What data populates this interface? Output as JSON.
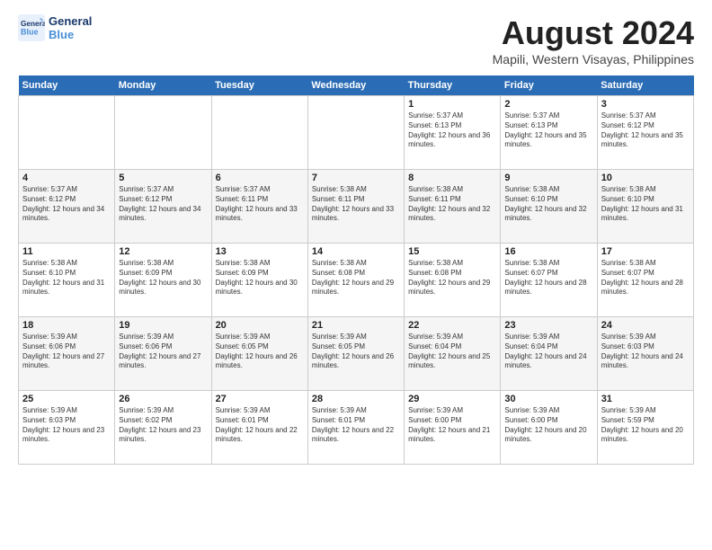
{
  "logo": {
    "line1": "General",
    "line2": "Blue"
  },
  "title": "August 2024",
  "location": "Mapili, Western Visayas, Philippines",
  "headers": [
    "Sunday",
    "Monday",
    "Tuesday",
    "Wednesday",
    "Thursday",
    "Friday",
    "Saturday"
  ],
  "weeks": [
    [
      {
        "day": "",
        "info": ""
      },
      {
        "day": "",
        "info": ""
      },
      {
        "day": "",
        "info": ""
      },
      {
        "day": "",
        "info": ""
      },
      {
        "day": "1",
        "info": "Sunrise: 5:37 AM\nSunset: 6:13 PM\nDaylight: 12 hours and 36 minutes."
      },
      {
        "day": "2",
        "info": "Sunrise: 5:37 AM\nSunset: 6:13 PM\nDaylight: 12 hours and 35 minutes."
      },
      {
        "day": "3",
        "info": "Sunrise: 5:37 AM\nSunset: 6:12 PM\nDaylight: 12 hours and 35 minutes."
      }
    ],
    [
      {
        "day": "4",
        "info": "Sunrise: 5:37 AM\nSunset: 6:12 PM\nDaylight: 12 hours and 34 minutes."
      },
      {
        "day": "5",
        "info": "Sunrise: 5:37 AM\nSunset: 6:12 PM\nDaylight: 12 hours and 34 minutes."
      },
      {
        "day": "6",
        "info": "Sunrise: 5:37 AM\nSunset: 6:11 PM\nDaylight: 12 hours and 33 minutes."
      },
      {
        "day": "7",
        "info": "Sunrise: 5:38 AM\nSunset: 6:11 PM\nDaylight: 12 hours and 33 minutes."
      },
      {
        "day": "8",
        "info": "Sunrise: 5:38 AM\nSunset: 6:11 PM\nDaylight: 12 hours and 32 minutes."
      },
      {
        "day": "9",
        "info": "Sunrise: 5:38 AM\nSunset: 6:10 PM\nDaylight: 12 hours and 32 minutes."
      },
      {
        "day": "10",
        "info": "Sunrise: 5:38 AM\nSunset: 6:10 PM\nDaylight: 12 hours and 31 minutes."
      }
    ],
    [
      {
        "day": "11",
        "info": "Sunrise: 5:38 AM\nSunset: 6:10 PM\nDaylight: 12 hours and 31 minutes."
      },
      {
        "day": "12",
        "info": "Sunrise: 5:38 AM\nSunset: 6:09 PM\nDaylight: 12 hours and 30 minutes."
      },
      {
        "day": "13",
        "info": "Sunrise: 5:38 AM\nSunset: 6:09 PM\nDaylight: 12 hours and 30 minutes."
      },
      {
        "day": "14",
        "info": "Sunrise: 5:38 AM\nSunset: 6:08 PM\nDaylight: 12 hours and 29 minutes."
      },
      {
        "day": "15",
        "info": "Sunrise: 5:38 AM\nSunset: 6:08 PM\nDaylight: 12 hours and 29 minutes."
      },
      {
        "day": "16",
        "info": "Sunrise: 5:38 AM\nSunset: 6:07 PM\nDaylight: 12 hours and 28 minutes."
      },
      {
        "day": "17",
        "info": "Sunrise: 5:38 AM\nSunset: 6:07 PM\nDaylight: 12 hours and 28 minutes."
      }
    ],
    [
      {
        "day": "18",
        "info": "Sunrise: 5:39 AM\nSunset: 6:06 PM\nDaylight: 12 hours and 27 minutes."
      },
      {
        "day": "19",
        "info": "Sunrise: 5:39 AM\nSunset: 6:06 PM\nDaylight: 12 hours and 27 minutes."
      },
      {
        "day": "20",
        "info": "Sunrise: 5:39 AM\nSunset: 6:05 PM\nDaylight: 12 hours and 26 minutes."
      },
      {
        "day": "21",
        "info": "Sunrise: 5:39 AM\nSunset: 6:05 PM\nDaylight: 12 hours and 26 minutes."
      },
      {
        "day": "22",
        "info": "Sunrise: 5:39 AM\nSunset: 6:04 PM\nDaylight: 12 hours and 25 minutes."
      },
      {
        "day": "23",
        "info": "Sunrise: 5:39 AM\nSunset: 6:04 PM\nDaylight: 12 hours and 24 minutes."
      },
      {
        "day": "24",
        "info": "Sunrise: 5:39 AM\nSunset: 6:03 PM\nDaylight: 12 hours and 24 minutes."
      }
    ],
    [
      {
        "day": "25",
        "info": "Sunrise: 5:39 AM\nSunset: 6:03 PM\nDaylight: 12 hours and 23 minutes."
      },
      {
        "day": "26",
        "info": "Sunrise: 5:39 AM\nSunset: 6:02 PM\nDaylight: 12 hours and 23 minutes."
      },
      {
        "day": "27",
        "info": "Sunrise: 5:39 AM\nSunset: 6:01 PM\nDaylight: 12 hours and 22 minutes."
      },
      {
        "day": "28",
        "info": "Sunrise: 5:39 AM\nSunset: 6:01 PM\nDaylight: 12 hours and 22 minutes."
      },
      {
        "day": "29",
        "info": "Sunrise: 5:39 AM\nSunset: 6:00 PM\nDaylight: 12 hours and 21 minutes."
      },
      {
        "day": "30",
        "info": "Sunrise: 5:39 AM\nSunset: 6:00 PM\nDaylight: 12 hours and 20 minutes."
      },
      {
        "day": "31",
        "info": "Sunrise: 5:39 AM\nSunset: 5:59 PM\nDaylight: 12 hours and 20 minutes."
      }
    ]
  ]
}
